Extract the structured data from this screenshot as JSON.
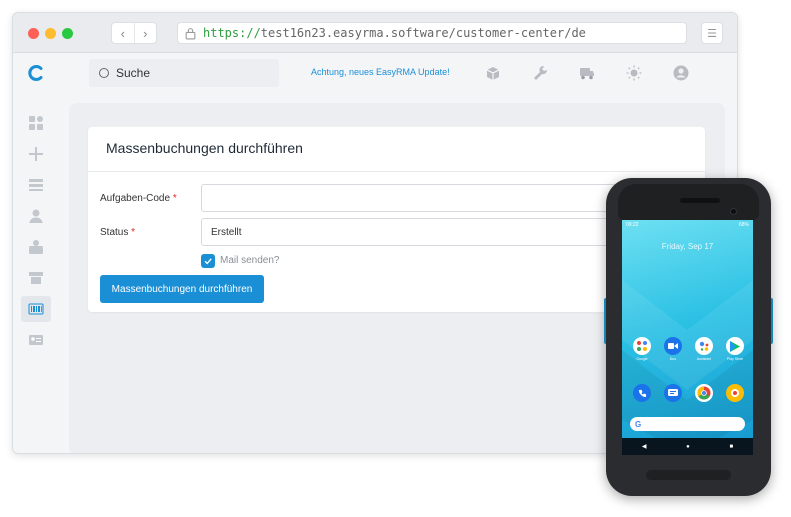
{
  "browser": {
    "url_scheme": "https://",
    "url_rest": "test16n23.easyrma.software/customer-center/de",
    "back_icon": "‹",
    "forward_icon": "›",
    "menu_icon": "☰"
  },
  "topbar": {
    "search_label": "Suche",
    "update_link": "Achtung, neues EasyRMA Update!",
    "icons": [
      "package-icon",
      "wrench-icon",
      "truck-icon",
      "sun-icon",
      "user-avatar-icon"
    ]
  },
  "sidebar": {
    "items": [
      "dashboard-icon",
      "plus-icon",
      "list-icon",
      "person-icon",
      "inbox-icon",
      "archive-icon",
      "barcode-icon",
      "contact-card-icon"
    ],
    "active_index": 6
  },
  "form": {
    "title": "Massenbuchungen durchführen",
    "fields": [
      {
        "label": "Aufgaben-Code",
        "required": "*",
        "value": ""
      },
      {
        "label": "Status",
        "required": "*",
        "value": "Erstellt"
      }
    ],
    "mail_checkbox": {
      "label": "Mail senden?",
      "checked": true
    },
    "submit_label": "Massenbuchungen durchführen"
  },
  "phone": {
    "status_time": "09:22",
    "status_battery": "68%",
    "clock": "Friday, Sep 17",
    "apps_row1": [
      "Google",
      "Duo",
      "Assistant",
      "Play Store"
    ],
    "google_letter": "G"
  },
  "colors": {
    "accent": "#1a8fd6",
    "required": "#e02424"
  }
}
